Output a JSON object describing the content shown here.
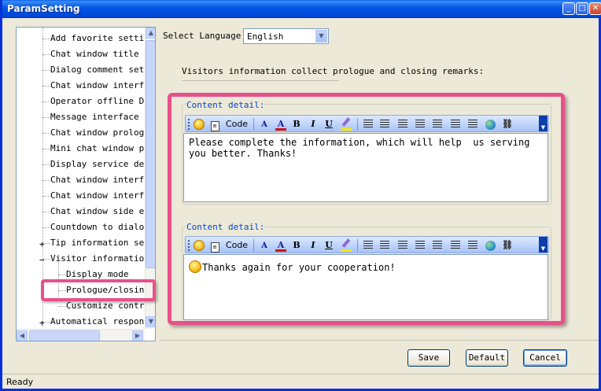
{
  "window": {
    "title": "ParamSetting"
  },
  "tree": {
    "items": [
      {
        "label": "Add favorite setting",
        "expander": ""
      },
      {
        "label": "Chat window title se",
        "expander": ""
      },
      {
        "label": "Dialog comment setti",
        "expander": ""
      },
      {
        "label": "Chat window interfac",
        "expander": ""
      },
      {
        "label": "Operator offline Dis",
        "expander": ""
      },
      {
        "label": "Message interface se",
        "expander": ""
      },
      {
        "label": "Chat window prologue",
        "expander": ""
      },
      {
        "label": "Mini chat window pro",
        "expander": ""
      },
      {
        "label": "Display service deps",
        "expander": ""
      },
      {
        "label": "Chat window interfac",
        "expander": ""
      },
      {
        "label": "Chat window interfac",
        "expander": ""
      },
      {
        "label": "Chat window side edg",
        "expander": ""
      },
      {
        "label": "Countdown to dialog",
        "expander": ""
      },
      {
        "label": "Tip information sett",
        "expander": "+"
      },
      {
        "label": "Visitor information",
        "expander": "−"
      },
      {
        "label": "Display mode",
        "expander": ""
      },
      {
        "label": "Prologue/closing",
        "expander": ""
      },
      {
        "label": "Customize control",
        "expander": ""
      },
      {
        "label": "Automatical response",
        "expander": "+"
      }
    ]
  },
  "language": {
    "label": "Select Language",
    "value": "English"
  },
  "intro": "Visitors information collect prologue and closing remarks:",
  "editor1": {
    "group_label": "Content detail:",
    "content": "Please complete the information, which will help  us serving you better. Thanks!"
  },
  "editor2": {
    "group_label": "Content detail:",
    "content": "Thanks again for your cooperation!"
  },
  "toolbar": {
    "code_label": "Code",
    "bold": "B",
    "italic": "I",
    "underline": "U",
    "font_size": "A",
    "font_color": "A",
    "font_color_hex": "#d11212",
    "highlight_color_hex": "#f5e600"
  },
  "buttons": {
    "save": "Save",
    "default": "Default",
    "cancel": "Cancel"
  },
  "status": "Ready",
  "icons": [
    "smiley-icon",
    "template-icon",
    "font-size-icon",
    "font-color-icon",
    "highlight-icon",
    "ordered-list-icon",
    "unordered-list-icon",
    "align-left-icon",
    "align-center-icon",
    "align-right-icon",
    "outdent-icon",
    "indent-icon",
    "link-icon",
    "unlink-icon"
  ]
}
